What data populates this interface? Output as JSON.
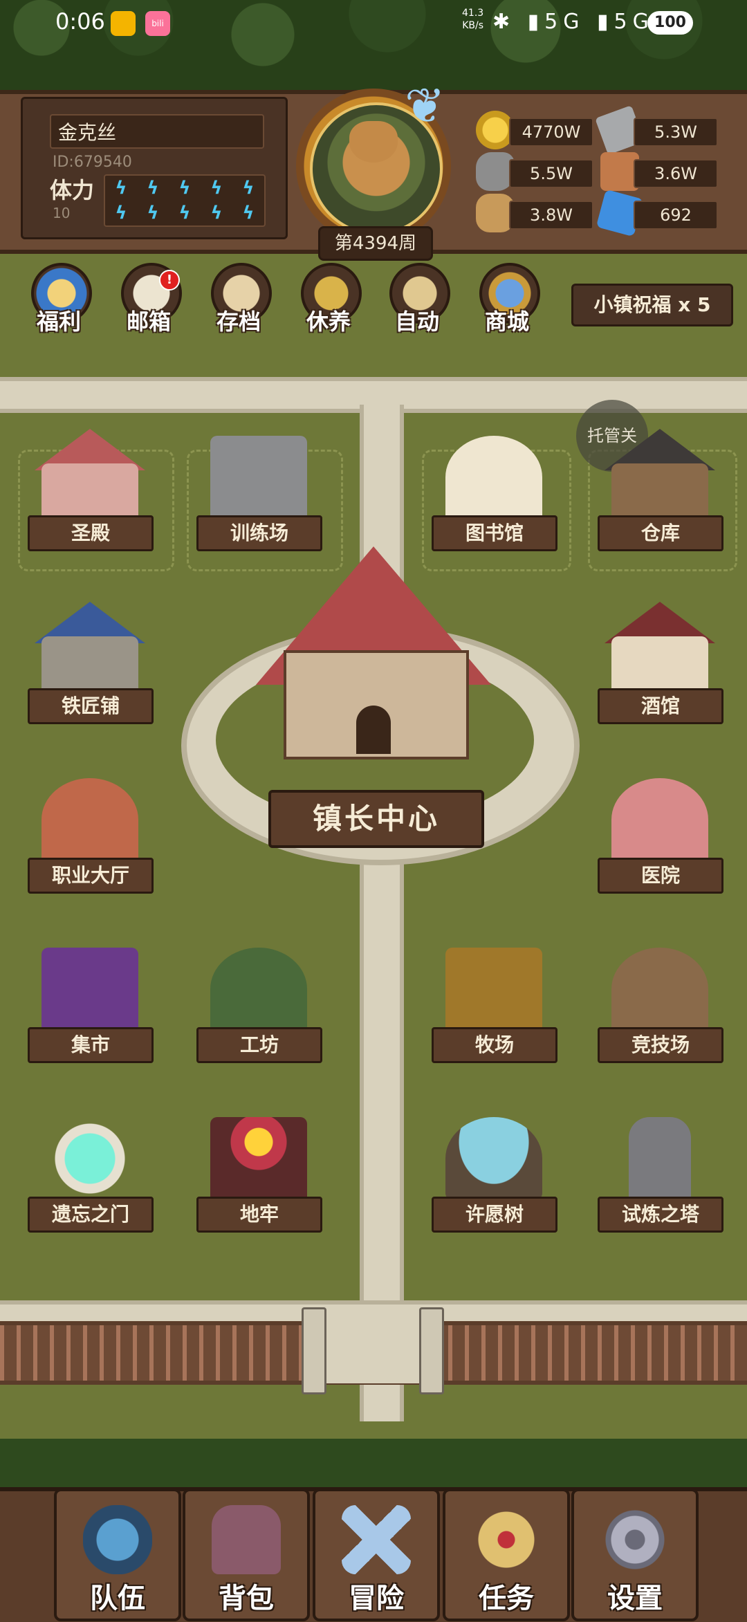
{
  "status_bar": {
    "time": "0:06",
    "net_speed_value": "41.3",
    "net_speed_unit": "KB/s",
    "signal_icons": "✱ ▮5G ▮5G ≋",
    "battery": "100",
    "app2_text": "bili"
  },
  "player": {
    "name": "金克丝",
    "id": "ID:679540",
    "stamina_label": "体力",
    "stamina_value": "10",
    "stamina_bolts": [
      "ϟ",
      "ϟ",
      "ϟ",
      "ϟ",
      "ϟ",
      "ϟ",
      "ϟ",
      "ϟ",
      "ϟ",
      "ϟ"
    ],
    "week": "第4394周"
  },
  "resources": {
    "gold": "4770W",
    "iron": "5.3W",
    "stone": "5.5W",
    "leather": "3.6W",
    "wood": "3.8W",
    "crystal": "692"
  },
  "top_menu": {
    "welfare": "福利",
    "mail": "邮箱",
    "mail_badge": "!",
    "save": "存档",
    "rest": "休养",
    "auto": "自动",
    "shop": "商城"
  },
  "blessing": "小镇祝福 x 5",
  "auto_toggle": "托管关",
  "buildings": {
    "temple": "圣殿",
    "training": "训练场",
    "library": "图书馆",
    "warehouse": "仓库",
    "blacksmith": "铁匠铺",
    "tavern": "酒馆",
    "job_hall": "职业大厅",
    "hospital": "医院",
    "market": "集市",
    "workshop": "工坊",
    "ranch": "牧场",
    "arena": "竞技场",
    "forgotten_gate": "遗忘之门",
    "dungeon": "地牢",
    "wishing_tree": "许愿树",
    "trial_tower": "试炼之塔",
    "mayor_center": "镇长中心"
  },
  "bottom_nav": {
    "team": "队伍",
    "bag": "背包",
    "adventure": "冒险",
    "quest": "任务",
    "settings": "设置"
  },
  "colors": {
    "panel_brown": "#5b3d2a",
    "grass": "#6e7838",
    "road": "#d9d2bd",
    "stamina_blue": "#4fc8f0",
    "badge_red": "#e02020"
  }
}
